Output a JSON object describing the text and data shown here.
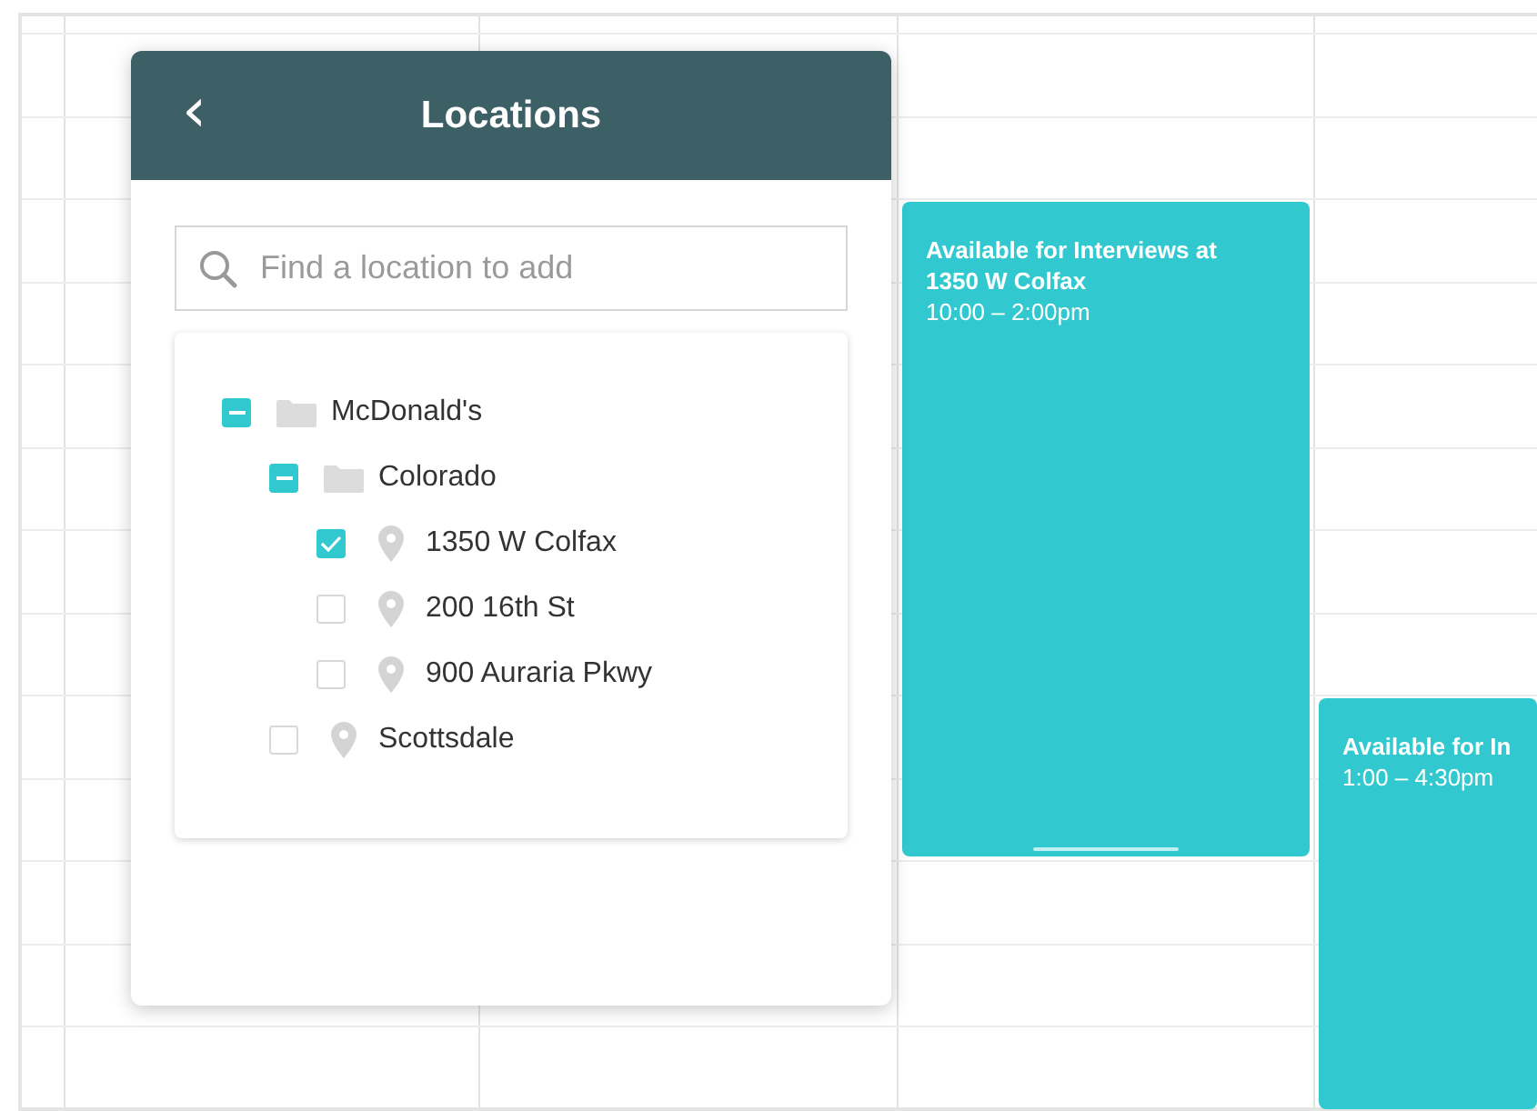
{
  "panel": {
    "title": "Locations",
    "back_icon": "‹",
    "search": {
      "placeholder": "Find a location to add"
    },
    "tree": [
      {
        "label": "McDonald's",
        "kind": "folder",
        "checked": false,
        "indeterminate": true,
        "children": [
          {
            "label": "Colorado",
            "kind": "folder",
            "checked": false,
            "indeterminate": true,
            "children": [
              {
                "label": "1350 W Colfax",
                "kind": "location",
                "checked": true,
                "indeterminate": false
              },
              {
                "label": "200 16th St",
                "kind": "location",
                "checked": false,
                "indeterminate": false
              },
              {
                "label": "900 Auraria Pkwy",
                "kind": "location",
                "checked": false,
                "indeterminate": false
              }
            ]
          },
          {
            "label": "Scottsdale",
            "kind": "location",
            "checked": false,
            "indeterminate": false
          }
        ]
      }
    ]
  },
  "events": [
    {
      "title": "Available for Interviews at 1350 W Colfax",
      "time": "10:00 – 2:00pm",
      "handle": true
    },
    {
      "title": "Available for In",
      "time": "1:00 – 4:30pm",
      "handle": false
    }
  ]
}
